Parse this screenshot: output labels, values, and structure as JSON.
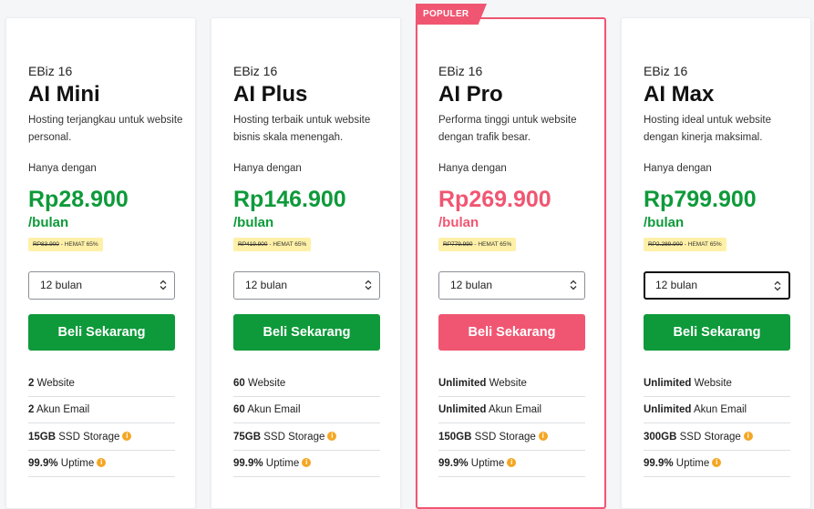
{
  "badge": "POPULER",
  "plans": [
    {
      "series": "EBiz 16",
      "name": "AI Mini",
      "desc": "Hosting terjangkau untuk website personal.",
      "only": "Hanya dengan",
      "price": "Rp28.900",
      "per": "/bulan",
      "old_price": "RP83.900",
      "save": "- HEMAT 65%",
      "period": "12 bulan",
      "buy": "Beli Sekarang",
      "features": [
        {
          "bold": "2",
          "text": " Website",
          "info": false
        },
        {
          "bold": "2",
          "text": " Akun Email",
          "info": false
        },
        {
          "bold": "15GB",
          "text": " SSD Storage",
          "info": true
        },
        {
          "bold": "99.9%",
          "text": " Uptime",
          "info": true
        }
      ]
    },
    {
      "series": "EBiz 16",
      "name": "AI Plus",
      "desc": "Hosting terbaik untuk website bisnis skala menengah.",
      "only": "Hanya dengan",
      "price": "Rp146.900",
      "per": "/bulan",
      "old_price": "RP419.900",
      "save": "- HEMAT 65%",
      "period": "12 bulan",
      "buy": "Beli Sekarang",
      "features": [
        {
          "bold": "60",
          "text": " Website",
          "info": false
        },
        {
          "bold": "60",
          "text": " Akun Email",
          "info": false
        },
        {
          "bold": "75GB",
          "text": " SSD Storage",
          "info": true
        },
        {
          "bold": "99.9%",
          "text": " Uptime",
          "info": true
        }
      ]
    },
    {
      "series": "EBiz 16",
      "name": "AI Pro",
      "desc": "Performa tinggi untuk website dengan trafik besar.",
      "only": "Hanya dengan",
      "price": "Rp269.900",
      "per": "/bulan",
      "old_price": "RP779.990",
      "save": "- HEMAT 65%",
      "period": "12 bulan",
      "buy": "Beli Sekarang",
      "features": [
        {
          "bold": "Unlimited",
          "text": " Website",
          "info": false
        },
        {
          "bold": "Unlimited",
          "text": " Akun Email",
          "info": false
        },
        {
          "bold": "150GB",
          "text": " SSD Storage",
          "info": true
        },
        {
          "bold": "99.9%",
          "text": " Uptime",
          "info": true
        }
      ]
    },
    {
      "series": "EBiz 16",
      "name": "AI Max",
      "desc": "Hosting ideal untuk website dengan kinerja maksimal.",
      "only": "Hanya dengan",
      "price": "Rp799.900",
      "per": "/bulan",
      "old_price": "RP2.289.900",
      "save": "- HEMAT 65%",
      "period": "12 bulan",
      "buy": "Beli Sekarang",
      "features": [
        {
          "bold": "Unlimited",
          "text": " Website",
          "info": false
        },
        {
          "bold": "Unlimited",
          "text": " Akun Email",
          "info": false
        },
        {
          "bold": "300GB",
          "text": " SSD Storage",
          "info": true
        },
        {
          "bold": "99.9%",
          "text": " Uptime",
          "info": true
        }
      ]
    }
  ],
  "info_icon": "info-icon",
  "colors": {
    "accent_green": "#0e9a3a",
    "accent_pink": "#f05672",
    "save_bg": "#fff0a8"
  }
}
